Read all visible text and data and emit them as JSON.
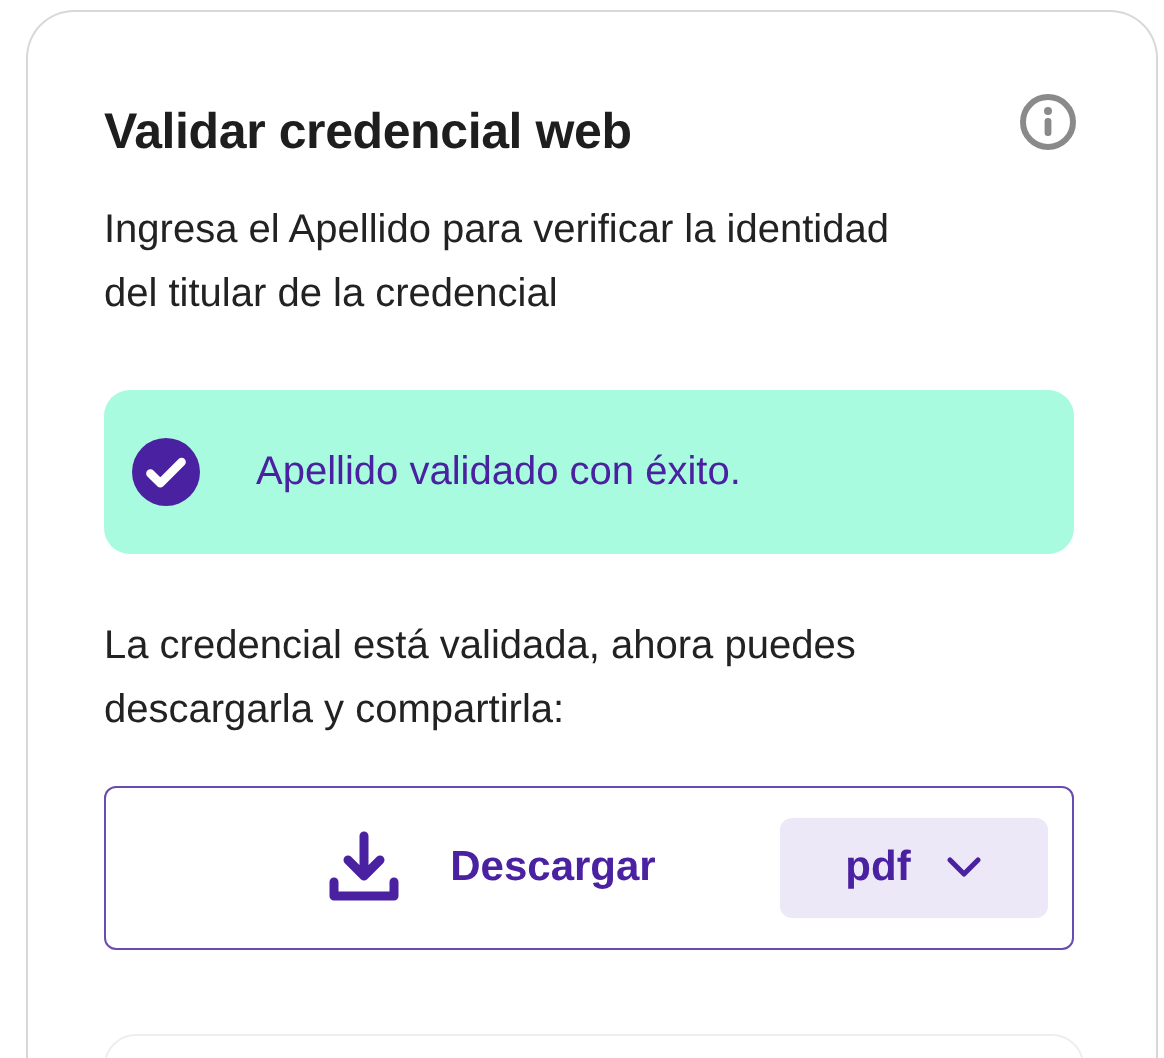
{
  "card": {
    "title": "Validar credencial web",
    "description": "Ingresa el Apellido para verificar la identidad del titular de la credencial",
    "alert": {
      "kind": "success",
      "text": "Apellido validado con éxito."
    },
    "message": "La credencial está validada, ahora puedes descargarla y compartirla:",
    "download": {
      "label": "Descargar",
      "format": "pdf"
    }
  }
}
